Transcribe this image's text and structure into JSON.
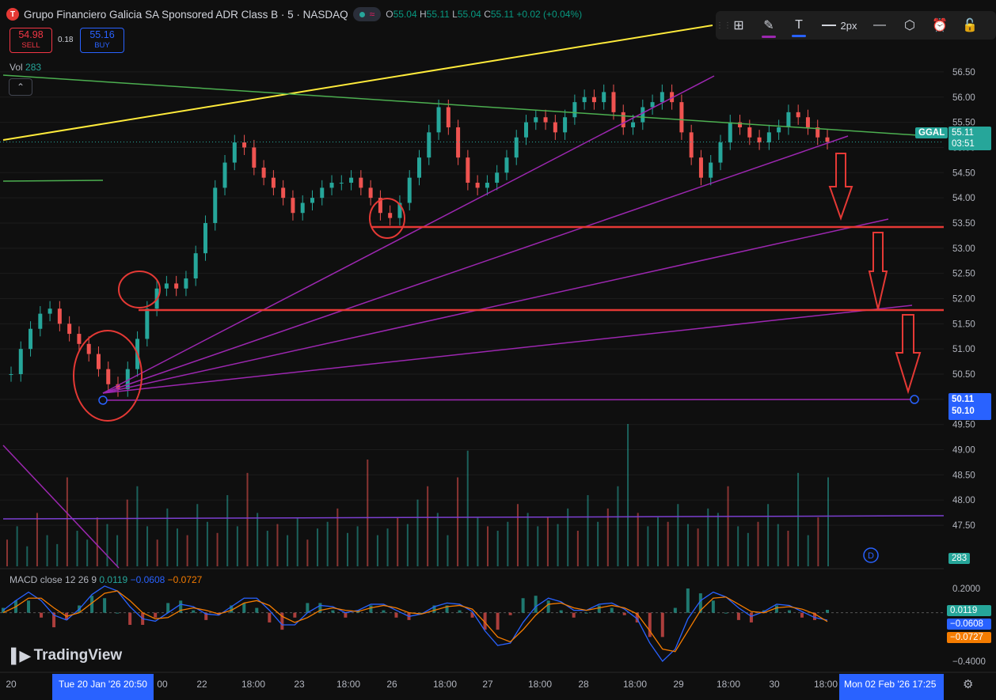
{
  "header": {
    "logo_letter": "T",
    "title": "Grupo Financiero Galicia SA Sponsored ADR Class B · 5 · NASDAQ",
    "wave_icon": "≈",
    "ohlc": {
      "o_label": "O",
      "o": "55.04",
      "h_label": "H",
      "h": "55.11",
      "l_label": "L",
      "l": "55.04",
      "c_label": "C",
      "c": "55.11",
      "change": "+0.02 (+0.04%)"
    }
  },
  "trade": {
    "sell_price": "54.98",
    "sell_label": "SELL",
    "spread": "0.18",
    "buy_price": "55.16",
    "buy_label": "BUY"
  },
  "volume": {
    "label": "Vol",
    "value": "283",
    "collapse_icon": "chevron-up-icon"
  },
  "toolbar": {
    "items": [
      "grip-icon",
      "layout-icon",
      "brush-icon",
      "text-icon",
      "line-style-icon",
      "line-icon",
      "settings-hex-icon",
      "alarm-clock-icon",
      "lock-icon"
    ],
    "width_label": "2px",
    "brush_color": "#9c27b0",
    "text_color": "#2962ff"
  },
  "macd": {
    "label": "MACD",
    "params": "close 12 26 9",
    "v1": "0.0119",
    "v2": "−0.0608",
    "v3": "−0.0727"
  },
  "brand": {
    "name": "TradingView"
  },
  "price_tags": {
    "symbol": "GGAL",
    "last": "55.11",
    "countdown": "03:51",
    "level_a": "50.11",
    "level_b": "50.10",
    "vol_tag": "283",
    "macd_a": "0.0119",
    "macd_b": "−0.0608",
    "macd_c": "−0.0727"
  },
  "dividend_marker": "D",
  "time_axis": {
    "labels": [
      "20",
      "00",
      "22",
      "18:00",
      "23",
      "18:00",
      "26",
      "18:00",
      "27",
      "18:00",
      "28",
      "18:00",
      "29",
      "18:00",
      "30",
      "18:00"
    ],
    "left_cursor": "Tue 20 Jan '26   20:50",
    "right_cursor": "Mon 02 Feb '26    17:25"
  },
  "colors": {
    "up": "#26a69a",
    "down": "#ef5350",
    "bg": "#0f0f0f",
    "purple": "#9c27b0",
    "red": "#e53935",
    "yellow": "#ffeb3b",
    "green": "#4caf50",
    "blue": "#2962ff"
  },
  "chart_data": [
    {
      "type": "line",
      "title": "",
      "ylim": [
        47.25,
        56.75
      ],
      "yticks": [
        "56.50",
        "56.00",
        "55.50",
        "55.00",
        "54.50",
        "54.00",
        "53.50",
        "53.00",
        "52.50",
        "52.00",
        "51.50",
        "51.00",
        "50.50",
        "50.00",
        "49.50",
        "49.00",
        "48.50",
        "48.00",
        "47.50"
      ],
      "series": [
        {
          "values": [
            50.5,
            51.0,
            51.4,
            51.7,
            51.8,
            51.5,
            51.3,
            51.1,
            50.9,
            50.6,
            50.3,
            50.2,
            50.6,
            51.2,
            51.8,
            52.2,
            52.3,
            52.2,
            52.4,
            52.9,
            53.5,
            54.2,
            54.7,
            55.1,
            55.0,
            54.6,
            54.4,
            54.2,
            54.0,
            53.7,
            53.9,
            54.0,
            54.2,
            54.3,
            54.3,
            54.4,
            54.2,
            54.0,
            53.7,
            53.6,
            53.9,
            54.4,
            54.8,
            55.3,
            55.8,
            55.4,
            54.8,
            54.3,
            54.2,
            54.3,
            54.5,
            54.8,
            55.2,
            55.5,
            55.6,
            55.5,
            55.3,
            55.6,
            55.9,
            56.0,
            55.9,
            56.1,
            55.7,
            55.4,
            55.5,
            55.8,
            55.9,
            56.1,
            55.9,
            55.3,
            54.8,
            54.4,
            54.7,
            55.1,
            55.5,
            55.4,
            55.2,
            55.1,
            55.3,
            55.4,
            55.7,
            55.6,
            55.4,
            55.2,
            55.11
          ]
        }
      ]
    },
    {
      "type": "bar",
      "title": "",
      "series": [
        {
          "values": [
            60,
            90,
            45,
            120,
            70,
            50,
            200,
            80,
            60,
            110,
            95,
            70,
            150,
            180,
            90,
            60,
            130,
            85,
            70,
            140,
            100,
            75,
            160,
            90,
            210,
            120,
            80,
            95,
            70,
            110,
            60,
            85,
            100,
            130,
            75,
            90,
            240,
            70,
            85,
            110,
            95,
            150,
            180,
            120,
            70,
            200,
            260,
            110,
            90,
            80,
            100,
            140,
            120,
            90,
            110,
            95,
            130,
            80,
            160,
            100,
            130,
            180,
            320,
            120,
            90,
            110,
            100,
            140,
            95,
            85,
            130,
            120,
            180,
            90,
            75,
            100,
            140,
            95,
            80,
            210,
            70,
            110,
            200
          ]
        }
      ]
    },
    {
      "type": "line",
      "title": "",
      "yticks": [
        "0.2000",
        "−0.4000"
      ],
      "series": [
        {
          "values": [
            0.05,
            0.15,
            0.2,
            0.05,
            -0.1,
            -0.05,
            0.1,
            0.2,
            0.25,
            0.15,
            0.0,
            -0.1,
            -0.05,
            0.05,
            0.1,
            0.02,
            -0.05,
            0.0,
            0.1,
            0.15,
            0.1,
            -0.05,
            -0.15,
            -0.05,
            0.05,
            0.08,
            0.02,
            -0.02,
            0.05,
            0.1,
            0.05,
            0.0,
            -0.05,
            0.02,
            0.08,
            0.1,
            0.05,
            -0.02,
            -0.25,
            -0.3,
            -0.2,
            0.0,
            0.1,
            0.15,
            0.05,
            -0.02,
            0.05,
            0.1,
            0.08,
            0.0,
            -0.1,
            -0.35,
            -0.45,
            -0.2,
            0.05,
            0.15,
            0.2,
            0.1,
            0.0,
            -0.05,
            0.05,
            0.1,
            0.05,
            -0.02,
            -0.05,
            0.0119
          ]
        },
        {
          "values": [
            0.02,
            0.1,
            0.17,
            0.1,
            -0.02,
            -0.06,
            0.03,
            0.15,
            0.22,
            0.18,
            0.05,
            -0.05,
            -0.07,
            0.0,
            0.07,
            0.05,
            -0.01,
            -0.02,
            0.05,
            0.12,
            0.12,
            0.02,
            -0.1,
            -0.1,
            0.0,
            0.06,
            0.05,
            0.0,
            0.02,
            0.07,
            0.07,
            0.02,
            -0.03,
            -0.01,
            0.05,
            0.08,
            0.07,
            0.01,
            -0.15,
            -0.27,
            -0.25,
            -0.08,
            0.05,
            0.12,
            0.09,
            0.02,
            0.02,
            0.07,
            0.08,
            0.03,
            -0.05,
            -0.25,
            -0.4,
            -0.3,
            -0.05,
            0.1,
            0.17,
            0.13,
            0.04,
            -0.03,
            0.01,
            0.07,
            0.06,
            0.01,
            -0.04,
            -0.0608
          ]
        },
        {
          "values": [
            0.0,
            0.05,
            0.12,
            0.12,
            0.04,
            -0.03,
            0.0,
            0.08,
            0.16,
            0.18,
            0.1,
            0.0,
            -0.05,
            -0.04,
            0.02,
            0.04,
            0.02,
            -0.01,
            0.02,
            0.08,
            0.1,
            0.06,
            -0.03,
            -0.08,
            -0.04,
            0.02,
            0.04,
            0.02,
            0.01,
            0.04,
            0.06,
            0.04,
            0.0,
            -0.01,
            0.02,
            0.05,
            0.06,
            0.03,
            -0.08,
            -0.2,
            -0.24,
            -0.14,
            -0.02,
            0.07,
            0.08,
            0.04,
            0.02,
            0.04,
            0.06,
            0.04,
            -0.01,
            -0.15,
            -0.3,
            -0.32,
            -0.15,
            0.02,
            0.12,
            0.13,
            0.07,
            0.01,
            0.0,
            0.04,
            0.05,
            0.03,
            -0.01,
            -0.0727
          ]
        }
      ]
    }
  ]
}
